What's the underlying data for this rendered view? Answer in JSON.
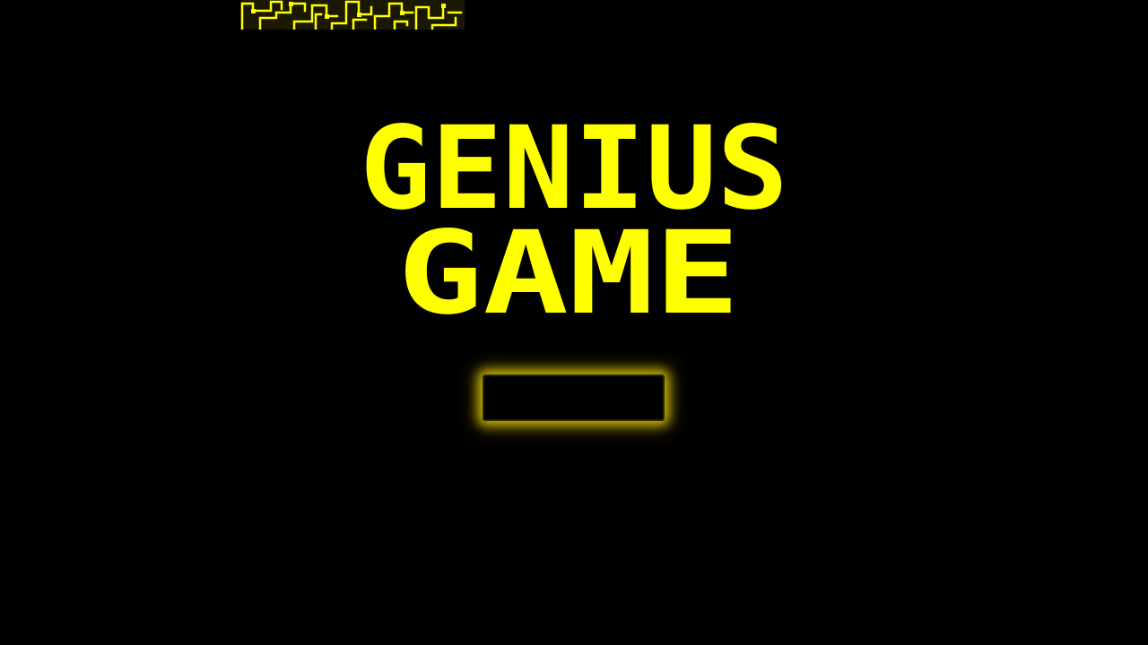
{
  "game": {
    "title_line1": "GENIUS",
    "title_line2": "GAME",
    "start_button_label": ""
  },
  "theme": {
    "background": "#000000",
    "accent": "#ffff00"
  },
  "decor": {
    "banner_icon": "circuit-pattern-icon"
  }
}
